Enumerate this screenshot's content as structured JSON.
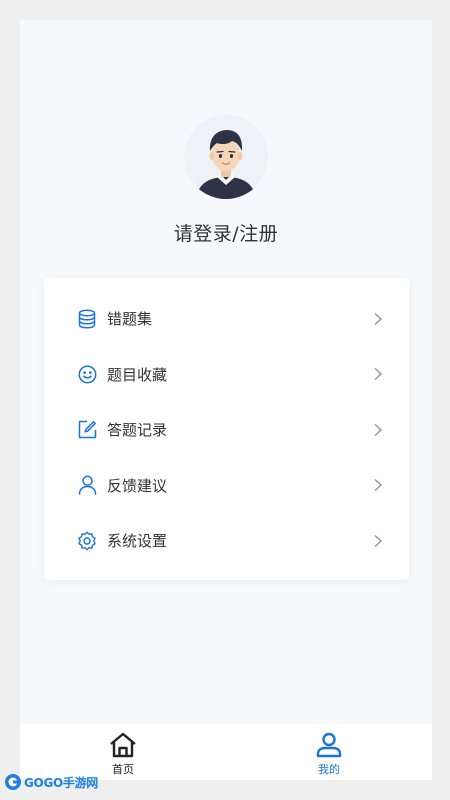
{
  "profile": {
    "login_text": "请登录/注册"
  },
  "menu": {
    "items": [
      {
        "label": "错题集",
        "icon": "database-icon"
      },
      {
        "label": "题目收藏",
        "icon": "smile-icon"
      },
      {
        "label": "答题记录",
        "icon": "edit-icon"
      },
      {
        "label": "反馈建议",
        "icon": "user-icon"
      },
      {
        "label": "系统设置",
        "icon": "gear-icon"
      }
    ]
  },
  "tabbar": {
    "home_label": "首页",
    "mine_label": "我的",
    "active": "mine"
  },
  "watermark": {
    "text": "GOGO手游网"
  },
  "colors": {
    "accent": "#1a73d9",
    "background": "#f6f8fc"
  }
}
